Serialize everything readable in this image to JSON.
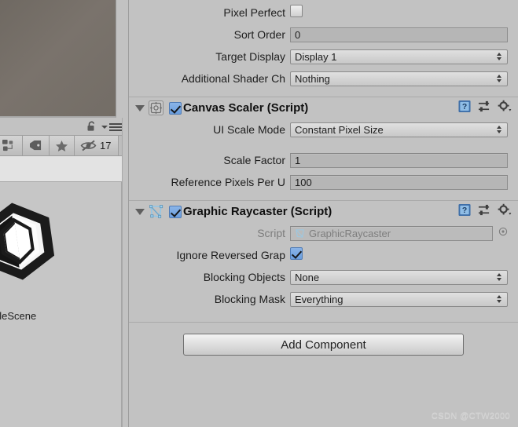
{
  "watermark": "CSDN @CTW2000",
  "left_panel": {
    "lock_icon": "padlock-open-icon",
    "menu_icon": "hamburger-menu-icon",
    "toolbar": [
      {
        "icon": "object-hierarchy-icon",
        "label": ""
      },
      {
        "icon": "tag-icon",
        "label": ""
      },
      {
        "icon": "star-icon",
        "label": ""
      },
      {
        "icon": "eye-slash-icon",
        "label": "17"
      }
    ],
    "scene_name": "pleScene",
    "logo_icon": "unity-logo-icon"
  },
  "inspector": {
    "canvas_tail_properties": [
      {
        "label": "Pixel Perfect",
        "type": "checkbox",
        "value": false
      },
      {
        "label": "Sort Order",
        "type": "text",
        "value": "0"
      },
      {
        "label": "Target Display",
        "type": "dropdown",
        "value": "Display 1"
      },
      {
        "label": "Additional Shader Ch",
        "type": "dropdown",
        "value": "Nothing"
      }
    ],
    "components": [
      {
        "title": "Canvas Scaler (Script)",
        "icon": "canvas-scaler-icon",
        "enabled": true,
        "expanded": true,
        "tools": [
          "help-icon",
          "preset-icon",
          "gear-icon"
        ],
        "properties": [
          {
            "label": "UI Scale Mode",
            "type": "dropdown",
            "value": "Constant Pixel Size"
          },
          {
            "label": "",
            "type": "spacer",
            "value": ""
          },
          {
            "label": "Scale Factor",
            "type": "text",
            "value": "1"
          },
          {
            "label": "Reference Pixels Per U",
            "type": "text",
            "value": "100"
          }
        ]
      },
      {
        "title": "Graphic Raycaster (Script)",
        "icon": "graphic-raycaster-icon",
        "enabled": true,
        "expanded": true,
        "tools": [
          "help-icon",
          "preset-icon",
          "gear-icon"
        ],
        "properties": [
          {
            "label": "Script",
            "type": "object",
            "value": "GraphicRaycaster",
            "dim": true
          },
          {
            "label": "Ignore Reversed Grap",
            "type": "checkbox",
            "value": true
          },
          {
            "label": "Blocking Objects",
            "type": "dropdown",
            "value": "None"
          },
          {
            "label": "Blocking Mask",
            "type": "dropdown",
            "value": "Everything"
          }
        ]
      }
    ],
    "add_component_label": "Add Component"
  },
  "colors": {
    "panel_bg": "#c2c2c2",
    "field_bg": "#b6b6b6",
    "accent_checkbox": "#6a9ede",
    "text": "#1d1d1d",
    "text_dim": "#7c7c7c"
  }
}
